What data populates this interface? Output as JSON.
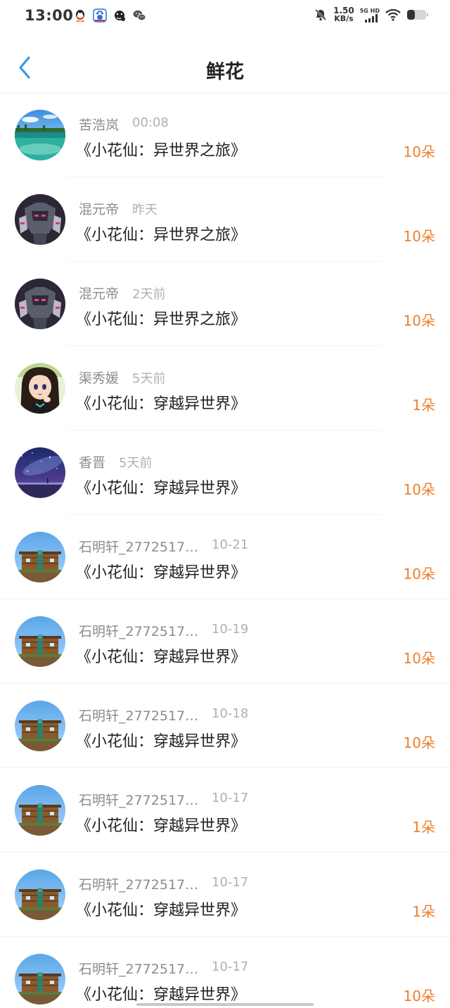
{
  "status_bar": {
    "time": "13:00",
    "net_speed_value": "1.50",
    "net_speed_unit": "KB/s",
    "network_type_top": "5G HD",
    "icons": [
      "qq-icon",
      "baidu-icon",
      "app-icon",
      "wechat-icon",
      "mute-icon",
      "signal-icon",
      "wifi-icon",
      "battery-icon"
    ]
  },
  "header": {
    "title": "鲜花",
    "back_icon": "chevron-left-icon"
  },
  "colors": {
    "accent": "#2e9cf0",
    "quantity": "#f07d2a",
    "name": "#8c8c8c",
    "time": "#b0b0b0",
    "title": "#222222"
  },
  "rows": [
    {
      "name": "苦浩岚",
      "time": "00:08",
      "book": "《小花仙：异世界之旅》",
      "qty": "10朵",
      "avatar": "sea-island"
    },
    {
      "name": "混元帝",
      "time": "昨天",
      "book": "《小花仙：异世界之旅》",
      "qty": "10朵",
      "avatar": "mecha-robot"
    },
    {
      "name": "混元帝",
      "time": "2天前",
      "book": "《小花仙：异世界之旅》",
      "qty": "10朵",
      "avatar": "mecha-robot"
    },
    {
      "name": "渠秀媛",
      "time": "5天前",
      "book": "《小花仙：穿越异世界》",
      "qty": "1朵",
      "avatar": "anime-girl"
    },
    {
      "name": "香晋",
      "time": "5天前",
      "book": "《小花仙：穿越异世界》",
      "qty": "10朵",
      "avatar": "starry-sky"
    },
    {
      "name": "石明轩_2772517…",
      "time": "10-21",
      "book": "《小花仙：穿越异世界》",
      "qty": "10朵",
      "avatar": "minecraft-house"
    },
    {
      "name": "石明轩_2772517…",
      "time": "10-19",
      "book": "《小花仙：穿越异世界》",
      "qty": "10朵",
      "avatar": "minecraft-house"
    },
    {
      "name": "石明轩_2772517…",
      "time": "10-18",
      "book": "《小花仙：穿越异世界》",
      "qty": "10朵",
      "avatar": "minecraft-house"
    },
    {
      "name": "石明轩_2772517…",
      "time": "10-17",
      "book": "《小花仙：穿越异世界》",
      "qty": "1朵",
      "avatar": "minecraft-house"
    },
    {
      "name": "石明轩_2772517…",
      "time": "10-17",
      "book": "《小花仙：穿越异世界》",
      "qty": "1朵",
      "avatar": "minecraft-house"
    },
    {
      "name": "石明轩_2772517…",
      "time": "10-17",
      "book": "《小花仙：穿越异世界》",
      "qty": "10朵",
      "avatar": "minecraft-house"
    }
  ]
}
